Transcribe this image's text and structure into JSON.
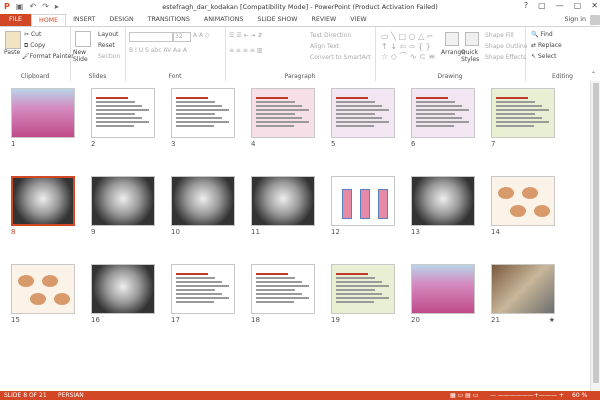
{
  "window": {
    "title": "estefragh_dar_kodakan [Compatibility Mode] - PowerPoint (Product Activation Failed)",
    "controls": [
      "?",
      "▢",
      "—",
      "▢",
      "✕"
    ]
  },
  "quick_access": [
    "save-icon",
    "undo-icon",
    "redo-icon",
    "start-icon"
  ],
  "tabs": [
    "FILE",
    "HOME",
    "INSERT",
    "DESIGN",
    "TRANSITIONS",
    "ANIMATIONS",
    "SLIDE SHOW",
    "REVIEW",
    "VIEW"
  ],
  "active_tab": "HOME",
  "signin": "Sign in",
  "ribbon": {
    "clipboard": {
      "label": "Clipboard",
      "paste": "Paste",
      "cut": "Cut",
      "copy": "Copy",
      "format_painter": "Format Painter"
    },
    "slides": {
      "label": "Slides",
      "new_slide": "New Slide",
      "layout": "Layout",
      "reset": "Reset",
      "section": "Section"
    },
    "font": {
      "label": "Font",
      "size": "32"
    },
    "paragraph": {
      "label": "Paragraph",
      "text_direction": "Text Direction",
      "align_text": "Align Text",
      "convert_smartart": "Convert to SmartArt"
    },
    "drawing": {
      "label": "Drawing",
      "arrange": "Arrange",
      "quick_styles": "Quick Styles",
      "shape_fill": "Shape Fill",
      "shape_outline": "Shape Outline",
      "shape_effects": "Shape Effects"
    },
    "editing": {
      "label": "Editing",
      "find": "Find",
      "replace": "Replace",
      "select": "Select"
    }
  },
  "slides": [
    {
      "n": "1",
      "kind": "flower"
    },
    {
      "n": "2",
      "kind": "text"
    },
    {
      "n": "3",
      "kind": "text"
    },
    {
      "n": "4",
      "kind": "pinklist"
    },
    {
      "n": "5",
      "kind": "table"
    },
    {
      "n": "6",
      "kind": "table"
    },
    {
      "n": "7",
      "kind": "green"
    },
    {
      "n": "8",
      "kind": "xray",
      "selected": true
    },
    {
      "n": "9",
      "kind": "xray"
    },
    {
      "n": "10",
      "kind": "xray"
    },
    {
      "n": "11",
      "kind": "xray"
    },
    {
      "n": "12",
      "kind": "diagram"
    },
    {
      "n": "13",
      "kind": "xray"
    },
    {
      "n": "14",
      "kind": "illus"
    },
    {
      "n": "15",
      "kind": "illus"
    },
    {
      "n": "16",
      "kind": "xray"
    },
    {
      "n": "17",
      "kind": "text"
    },
    {
      "n": "18",
      "kind": "text"
    },
    {
      "n": "19",
      "kind": "green"
    },
    {
      "n": "20",
      "kind": "flower"
    },
    {
      "n": "21",
      "kind": "photo"
    }
  ],
  "last_slide_marker": "★",
  "status": {
    "slide": "SLIDE 8 OF 21",
    "language": "PERSIAN",
    "zoom": "60 %"
  }
}
